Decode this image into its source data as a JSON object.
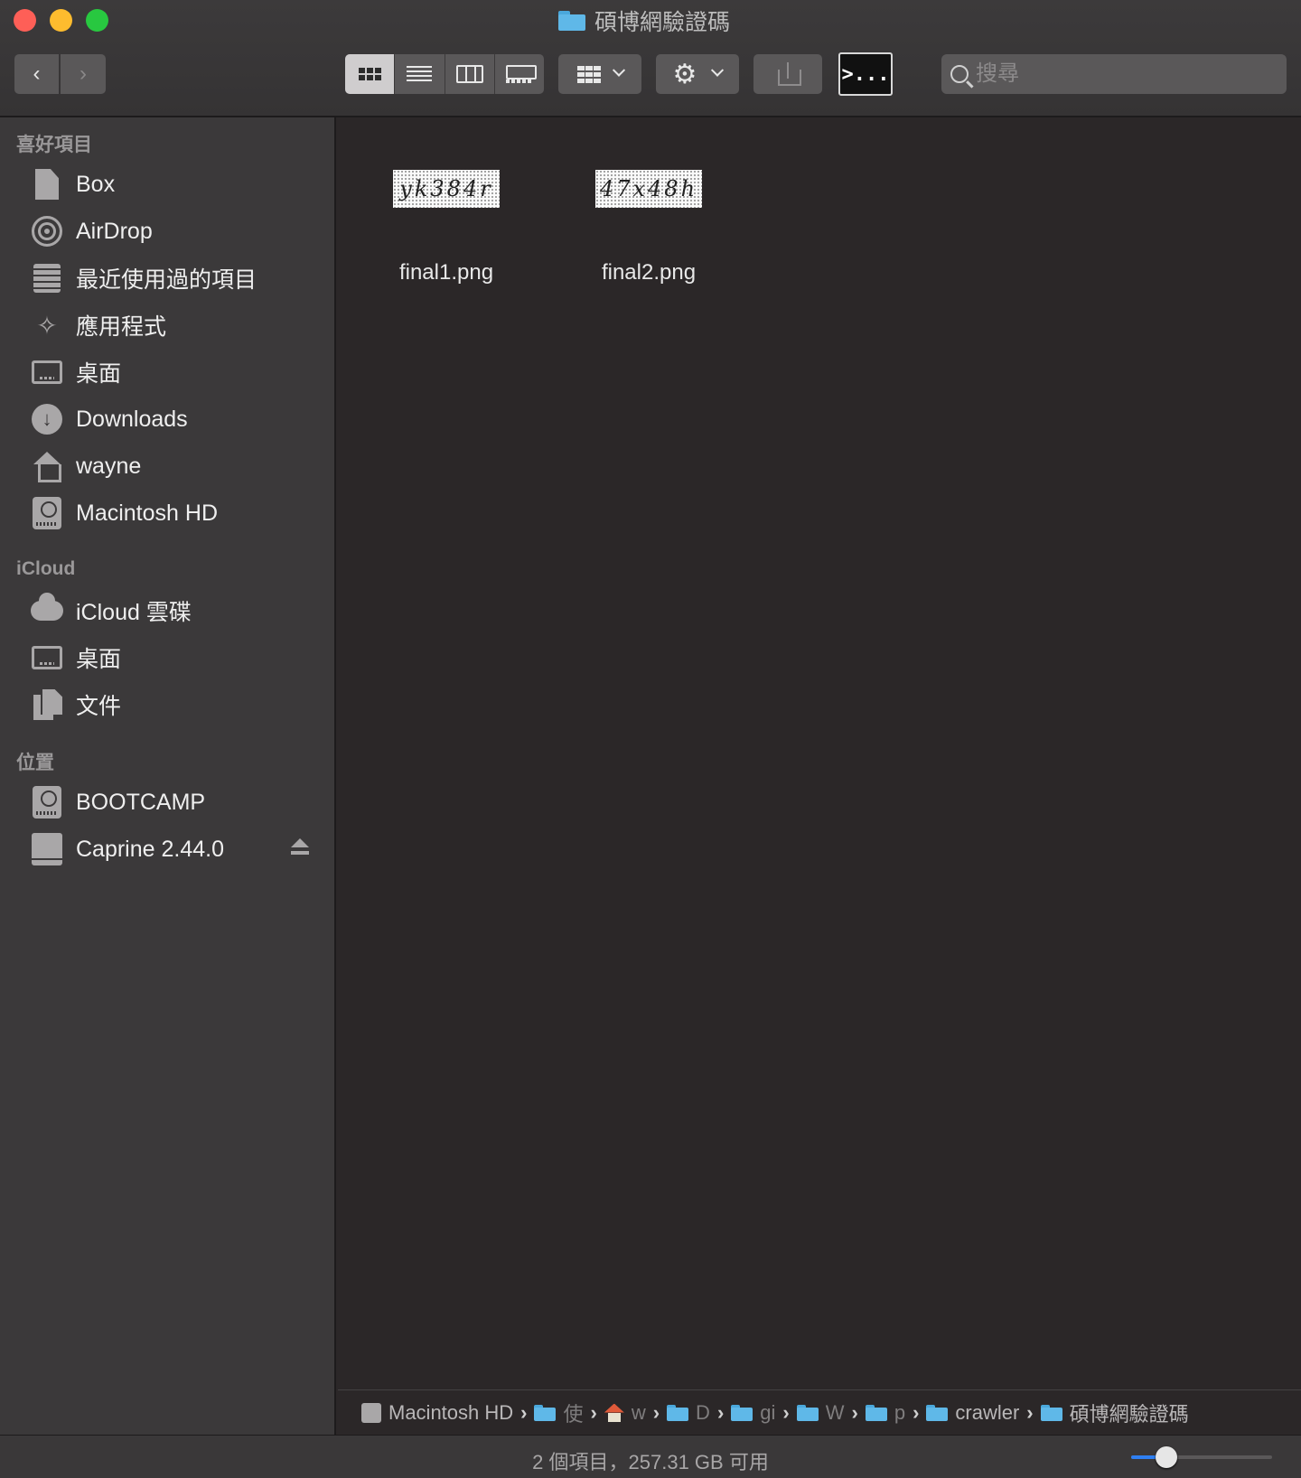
{
  "window": {
    "title": "碩博網驗證碼",
    "colors": {
      "background": "#2b2728",
      "sidebar": "#3b393a",
      "accent": "#2f7ff2",
      "folder": "#5fb8e8"
    }
  },
  "toolbar": {
    "back_icon": "chevron-left-icon",
    "forward_icon": "chevron-right-icon",
    "view_modes": [
      "icon-view",
      "list-view",
      "column-view",
      "gallery-view"
    ],
    "active_view": "icon-view",
    "terminal_label": ">...",
    "search_placeholder": "搜尋"
  },
  "sidebar": {
    "favorites_title": "喜好項目",
    "favorites": [
      {
        "label": "Box",
        "icon": "document-icon"
      },
      {
        "label": "AirDrop",
        "icon": "airdrop-icon"
      },
      {
        "label": "最近使用過的項目",
        "icon": "recents-icon"
      },
      {
        "label": "應用程式",
        "icon": "applications-icon"
      },
      {
        "label": "桌面",
        "icon": "desktop-icon"
      },
      {
        "label": "Downloads",
        "icon": "downloads-icon"
      },
      {
        "label": "wayne",
        "icon": "home-icon"
      },
      {
        "label": "Macintosh HD",
        "icon": "hard-disk-icon"
      }
    ],
    "icloud_title": "iCloud",
    "icloud": [
      {
        "label": "iCloud 雲碟",
        "icon": "cloud-icon"
      },
      {
        "label": "桌面",
        "icon": "desktop-icon"
      },
      {
        "label": "文件",
        "icon": "documents-icon"
      }
    ],
    "locations_title": "位置",
    "locations": [
      {
        "label": "BOOTCAMP",
        "icon": "hard-disk-icon"
      },
      {
        "label": "Caprine 2.44.0",
        "icon": "external-drive-icon"
      }
    ]
  },
  "files": [
    {
      "name": "final1.png",
      "thumb_text": "yk384r"
    },
    {
      "name": "final2.png",
      "thumb_text": "47x48h"
    }
  ],
  "pathbar": {
    "crumbs": [
      {
        "label": "Macintosh HD",
        "icon": "hard-disk-icon"
      },
      {
        "label": "使",
        "icon": "users-folder-icon"
      },
      {
        "label": "w",
        "icon": "home-icon"
      },
      {
        "label": "D",
        "icon": "downloads-folder-icon"
      },
      {
        "label": "gi",
        "icon": "folder-icon"
      },
      {
        "label": "W",
        "icon": "folder-icon"
      },
      {
        "label": "p",
        "icon": "folder-icon"
      },
      {
        "label": "crawler",
        "icon": "folder-icon"
      },
      {
        "label": "碩博網驗證碼",
        "icon": "folder-icon"
      }
    ]
  },
  "status": {
    "text": "2 個項目，257.31 GB 可用",
    "icon_size_fraction": 0.25
  }
}
